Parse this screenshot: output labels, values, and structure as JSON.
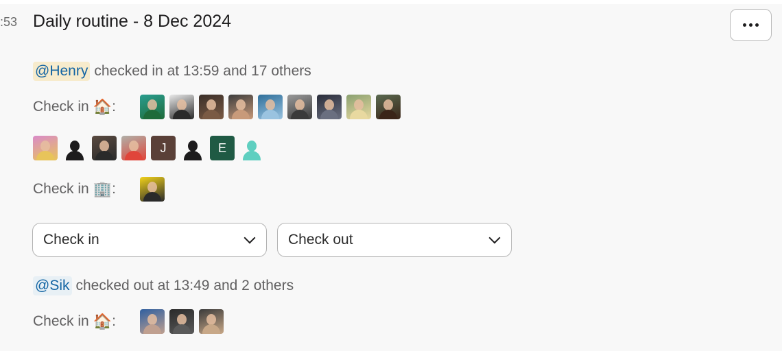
{
  "header": {
    "timestamp_fragment": ":53",
    "title": "Daily routine - 8 Dec 2024",
    "more_button_icon": "ellipsis-icon"
  },
  "checkin_summary": {
    "mention": "@Henry",
    "text": "checked in at 13:59 and 17 others"
  },
  "groups": [
    {
      "label": "Check in",
      "emoji": "🏠",
      "emoji_name": "house-icon",
      "avatars": [
        {
          "type": "photo",
          "colors": [
            "#2a9d8f",
            "#1e6b3a"
          ]
        },
        {
          "type": "photo",
          "colors": [
            "#e9e9e9",
            "#2a2a2a"
          ]
        },
        {
          "type": "photo",
          "colors": [
            "#3a2e28",
            "#7a5a44"
          ]
        },
        {
          "type": "photo",
          "colors": [
            "#3c3c3c",
            "#c89a7a"
          ]
        },
        {
          "type": "photo",
          "colors": [
            "#2f6f9a",
            "#9ac3e0"
          ]
        },
        {
          "type": "photo",
          "colors": [
            "#9a9a9a",
            "#3a3a3a"
          ]
        },
        {
          "type": "photo",
          "colors": [
            "#2a2d3a",
            "#6a6f80"
          ]
        },
        {
          "type": "photo",
          "colors": [
            "#8aa070",
            "#e8d9a0"
          ]
        },
        {
          "type": "photo",
          "colors": [
            "#5a6a50",
            "#3a2418"
          ]
        },
        {
          "type": "photo",
          "colors": [
            "#d98ac9",
            "#e8c45a"
          ]
        },
        {
          "type": "silhouette",
          "colors": [
            "#1d1c1d"
          ]
        },
        {
          "type": "photo",
          "colors": [
            "#5a4a40",
            "#2a2a2a"
          ]
        },
        {
          "type": "photo",
          "colors": [
            "#b0b0a8",
            "#e0453a"
          ]
        },
        {
          "type": "initial",
          "letter": "J",
          "colors": [
            "#5a4038"
          ]
        },
        {
          "type": "silhouette",
          "colors": [
            "#1d1c1d"
          ]
        },
        {
          "type": "initial",
          "letter": "E",
          "colors": [
            "#1f5a44"
          ]
        },
        {
          "type": "silhouette",
          "colors": [
            "#5fcfc0"
          ]
        }
      ]
    },
    {
      "label": "Check in",
      "emoji": "🏢",
      "emoji_name": "office-building-icon",
      "avatars": [
        {
          "type": "photo",
          "colors": [
            "#f2d21a",
            "#2a2a2a"
          ]
        }
      ]
    }
  ],
  "selects": [
    {
      "value": "Check in"
    },
    {
      "value": "Check out"
    }
  ],
  "checkout_summary": {
    "mention": "@Sik",
    "text": "checked out at 13:49 and 2 others"
  },
  "checkout_group": {
    "label": "Check in",
    "emoji": "🏠",
    "avatars": [
      {
        "type": "photo",
        "colors": [
          "#2f5fa0",
          "#c0a090"
        ]
      },
      {
        "type": "photo",
        "colors": [
          "#2a2a2a",
          "#5a5a5a"
        ]
      },
      {
        "type": "photo",
        "colors": [
          "#3a3a3a",
          "#c8a888"
        ]
      }
    ]
  }
}
